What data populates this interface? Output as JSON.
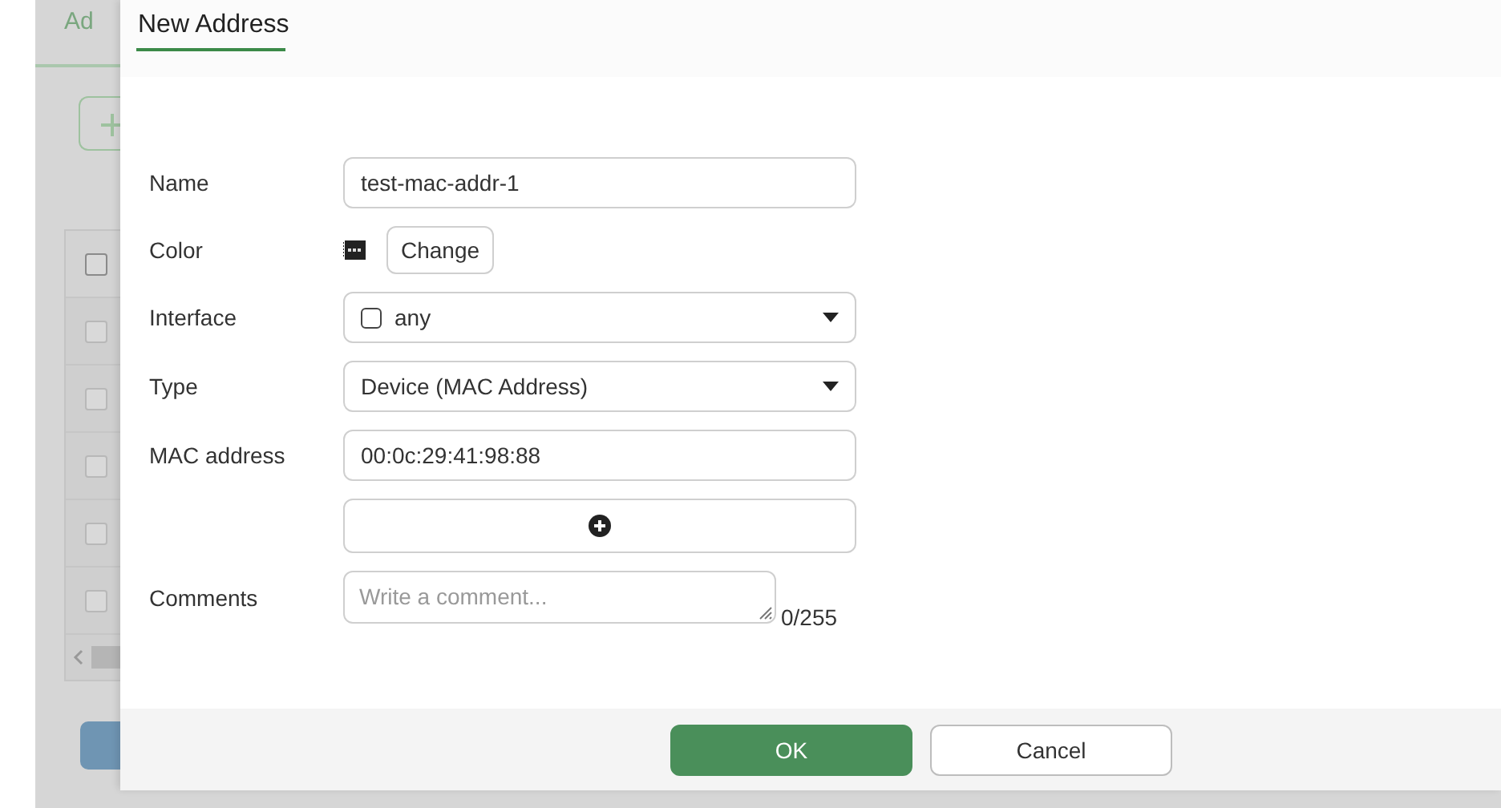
{
  "background": {
    "tab": "Ad",
    "rows": [
      {
        "checked": false
      },
      {
        "checked": false
      },
      {
        "checked": false
      },
      {
        "checked": false
      },
      {
        "checked": false
      },
      {
        "checked": false
      }
    ]
  },
  "dialog": {
    "title": "New Address",
    "fields": [
      {
        "kind": "text",
        "label": "Name",
        "value": "test-mac-addr-1"
      },
      {
        "kind": "color",
        "label": "Color",
        "button": "Change"
      },
      {
        "kind": "select",
        "label": "Interface",
        "value": "any",
        "checked": false
      },
      {
        "kind": "select",
        "label": "Type",
        "value": "Device (MAC Address)"
      },
      {
        "kind": "text",
        "label": "MAC address",
        "value": "00:0c:29:41:98:88"
      },
      {
        "kind": "add"
      },
      {
        "kind": "textarea",
        "label": "Comments",
        "placeholder": "Write a comment...",
        "counter": "0/255"
      }
    ],
    "buttons": [
      {
        "label": "OK",
        "primary": true
      },
      {
        "label": "Cancel",
        "primary": false
      }
    ]
  }
}
